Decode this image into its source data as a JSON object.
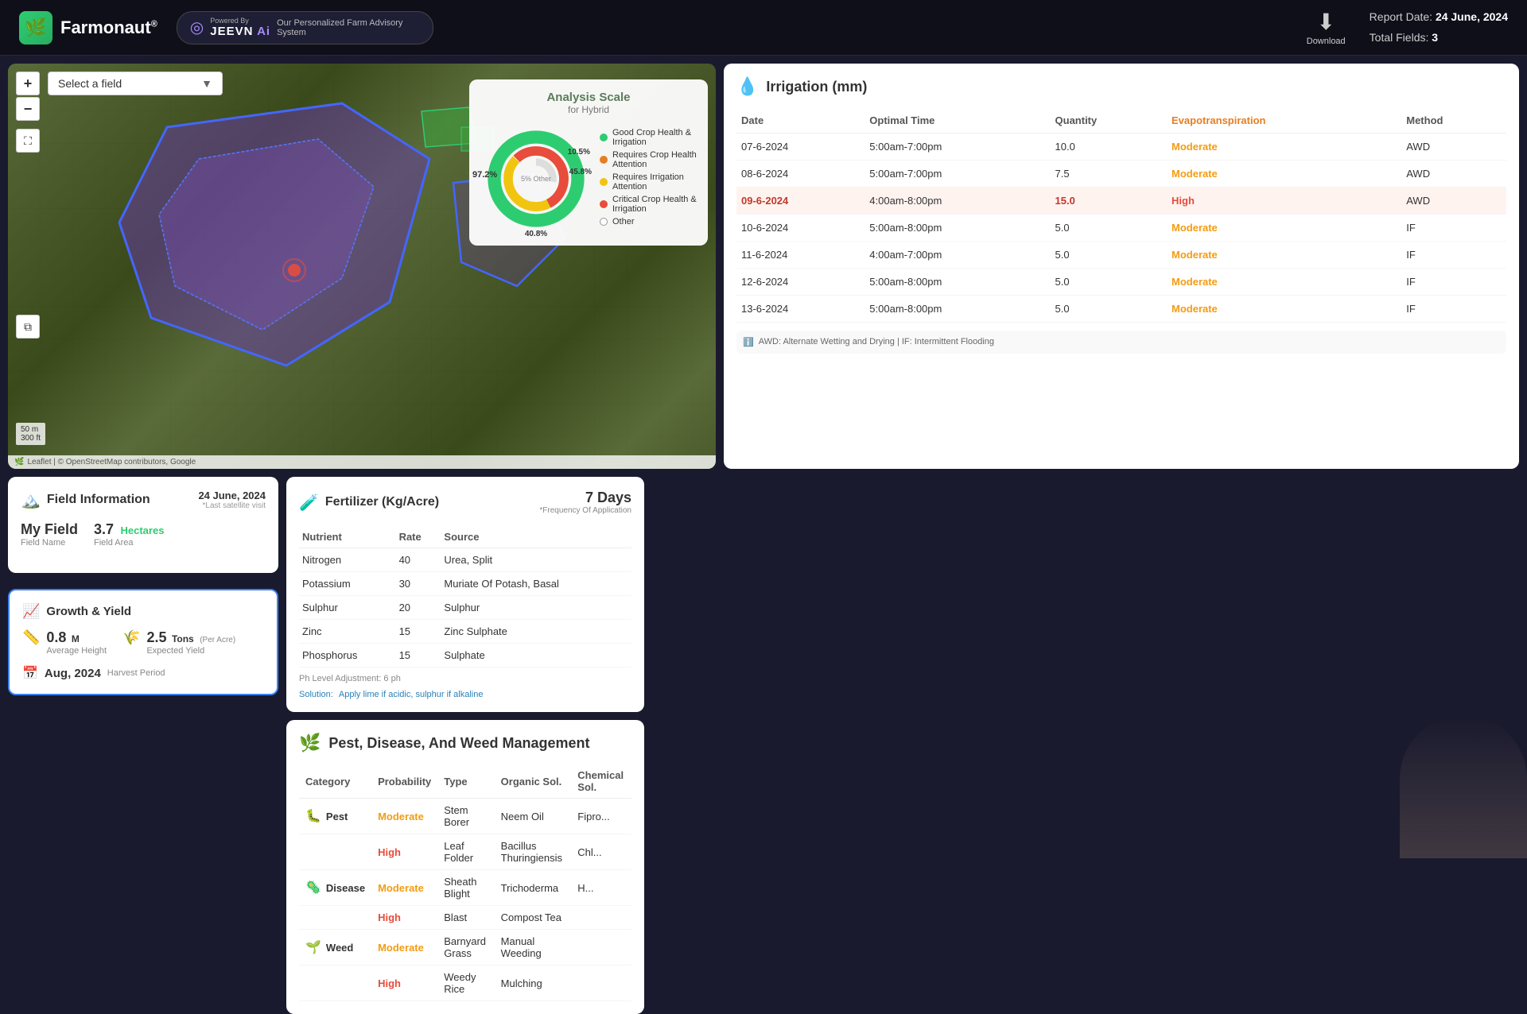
{
  "header": {
    "logo_text": "Farmonaut",
    "logo_reg": "®",
    "jeevn_name": "JEEVN Ai",
    "powered_by": "Powered By",
    "powered_desc": "Our Personalized Farm Advisory System",
    "download_label": "Download",
    "report_date_label": "Report Date:",
    "report_date_value": "24 June, 2024",
    "total_fields_label": "Total Fields:",
    "total_fields_value": "3"
  },
  "map": {
    "select_placeholder": "Select a field",
    "zoom_in": "+",
    "zoom_out": "−",
    "scale_50m": "50 m",
    "scale_300ft": "300 ft",
    "attribution": "Leaflet | © OpenStreetMap contributors, Google"
  },
  "analysis_scale": {
    "title": "Analysis Scale",
    "subtitle": "for Hybrid",
    "percent_good": "97.2%",
    "percent_crop_health": "10.5%",
    "percent_irrigation": "45.8%",
    "percent_other_label": "5% Other",
    "percent_critical": "40.8%",
    "legend": [
      {
        "color": "#2ecc71",
        "label": "Good Crop Health & Irrigation"
      },
      {
        "color": "#e67e22",
        "label": "Requires Crop Health Attention"
      },
      {
        "color": "#f1c40f",
        "label": "Requires Irrigation Attention"
      },
      {
        "color": "#e74c3c",
        "label": "Critical Crop Health & Irrigation"
      },
      {
        "color": "#ffffff",
        "label": "Other",
        "border": "#999"
      }
    ]
  },
  "irrigation": {
    "title": "Irrigation (mm)",
    "icon": "💧",
    "columns": [
      "Date",
      "Optimal Time",
      "Quantity",
      "Evapotranspiration",
      "Method"
    ],
    "rows": [
      {
        "date": "07-6-2024",
        "time": "5:00am-7:00pm",
        "qty": "10.0",
        "evap": "Moderate",
        "method": "AWD",
        "highlight": false
      },
      {
        "date": "08-6-2024",
        "time": "5:00am-7:00pm",
        "qty": "7.5",
        "evap": "Moderate",
        "method": "AWD",
        "highlight": false
      },
      {
        "date": "09-6-2024",
        "time": "4:00am-8:00pm",
        "qty": "15.0",
        "evap": "High",
        "method": "AWD",
        "highlight": true
      },
      {
        "date": "10-6-2024",
        "time": "5:00am-8:00pm",
        "qty": "5.0",
        "evap": "Moderate",
        "method": "IF",
        "highlight": false
      },
      {
        "date": "11-6-2024",
        "time": "4:00am-7:00pm",
        "qty": "5.0",
        "evap": "Moderate",
        "method": "IF",
        "highlight": false
      },
      {
        "date": "12-6-2024",
        "time": "5:00am-8:00pm",
        "qty": "5.0",
        "evap": "Moderate",
        "method": "IF",
        "highlight": false
      },
      {
        "date": "13-6-2024",
        "time": "5:00am-8:00pm",
        "qty": "5.0",
        "evap": "Moderate",
        "method": "IF",
        "highlight": false
      }
    ],
    "note": "AWD: Alternate Wetting and Drying | IF: Intermittent Flooding"
  },
  "field_info": {
    "title": "Field Information",
    "icon": "🏔️",
    "date": "24 June, 2024",
    "last_visit_label": "*Last satellite visit",
    "field_name_label": "Field Name",
    "field_name_value": "My Field",
    "area_label": "Field Area",
    "area_value": "3.7",
    "area_unit": "Hectares"
  },
  "growth": {
    "title": "Growth & Yield",
    "icon": "📈",
    "height_value": "0.8",
    "height_unit": "M",
    "height_label": "Average Height",
    "yield_value": "2.5",
    "yield_unit": "Tons",
    "yield_per": "(Per Acre)",
    "yield_label": "Expected Yield",
    "harvest_value": "Aug, 2024",
    "harvest_label": "Harvest Period"
  },
  "fertilizer": {
    "title": "Fertilizer (Kg/Acre)",
    "icon": "🧪",
    "days": "7 Days",
    "freq_label": "*Frequency Of Application",
    "columns": [
      "Nutrient",
      "Rate",
      "Source"
    ],
    "rows": [
      {
        "nutrient": "Nitrogen",
        "rate": "40",
        "source": "Urea, Split"
      },
      {
        "nutrient": "Potassium",
        "rate": "30",
        "source": "Muriate Of Potash, Basal"
      },
      {
        "nutrient": "Sulphur",
        "rate": "20",
        "source": "Sulphur"
      },
      {
        "nutrient": "Zinc",
        "rate": "15",
        "source": "Zinc Sulphate"
      },
      {
        "nutrient": "Phosphorus",
        "rate": "15",
        "source": "Sulphate"
      }
    ],
    "ph_note": "Ph Level Adjustment: 6 ph",
    "solution_label": "Solution:",
    "solution_text": "Apply lime if acidic, sulphur if alkaline"
  },
  "pest": {
    "title": "Pest, Disease, And Weed Management",
    "icon": "🌿",
    "columns": [
      "Category",
      "Probability",
      "Type",
      "Organic Sol.",
      "Chemical Sol."
    ],
    "rows": [
      {
        "category": "Pest",
        "cat_icon": "🐛",
        "probability": "Moderate",
        "prob_class": "moderate",
        "type": "Stem Borer",
        "organic": "Neem Oil",
        "chemical": "Fipro..."
      },
      {
        "category": "Pest",
        "cat_icon": "🐛",
        "probability": "High",
        "prob_class": "high",
        "type": "Leaf Folder",
        "organic": "Bacillus Thuringiensis",
        "chemical": "Chl..."
      },
      {
        "category": "Disease",
        "cat_icon": "🦠",
        "probability": "Moderate",
        "prob_class": "moderate",
        "type": "Sheath Blight",
        "organic": "Trichoderma",
        "chemical": "H..."
      },
      {
        "category": "Disease",
        "cat_icon": "🦠",
        "probability": "High",
        "prob_class": "high",
        "type": "Blast",
        "organic": "Compost Tea",
        "chemical": ""
      },
      {
        "category": "Weed",
        "cat_icon": "🌱",
        "probability": "Moderate",
        "prob_class": "moderate",
        "type": "Barnyard Grass",
        "organic": "Manual Weeding",
        "chemical": ""
      },
      {
        "category": "Weed",
        "cat_icon": "🌱",
        "probability": "High",
        "prob_class": "high",
        "type": "Weedy Rice",
        "organic": "Mulching",
        "chemical": ""
      }
    ]
  },
  "colors": {
    "accent_green": "#2ecc71",
    "accent_blue": "#3b82f6",
    "moderate": "#f39c12",
    "high": "#e74c3c",
    "header_bg": "#0f0f1a",
    "panel_bg": "#ffffff"
  }
}
